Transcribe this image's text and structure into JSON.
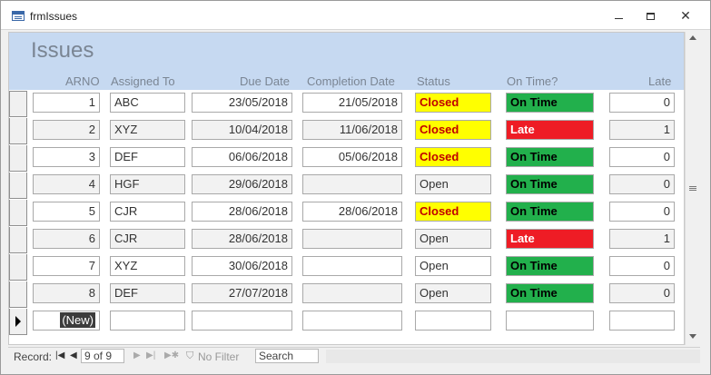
{
  "window": {
    "title": "frmIssues"
  },
  "form": {
    "title": "Issues",
    "columns": [
      "ARNO",
      "Assigned To",
      "Due Date",
      "Completion Date",
      "Status",
      "On Time?",
      "Late"
    ]
  },
  "rows": [
    {
      "arno": "1",
      "assigned": "ABC",
      "due": "23/05/2018",
      "completion": "21/05/2018",
      "status": "Closed",
      "ontime": "On Time",
      "late": "0"
    },
    {
      "arno": "2",
      "assigned": "XYZ",
      "due": "10/04/2018",
      "completion": "11/06/2018",
      "status": "Closed",
      "ontime": "Late",
      "late": "1"
    },
    {
      "arno": "3",
      "assigned": "DEF",
      "due": "06/06/2018",
      "completion": "05/06/2018",
      "status": "Closed",
      "ontime": "On Time",
      "late": "0"
    },
    {
      "arno": "4",
      "assigned": "HGF",
      "due": "29/06/2018",
      "completion": "",
      "status": "Open",
      "ontime": "On Time",
      "late": "0"
    },
    {
      "arno": "5",
      "assigned": "CJR",
      "due": "28/06/2018",
      "completion": "28/06/2018",
      "status": "Closed",
      "ontime": "On Time",
      "late": "0"
    },
    {
      "arno": "6",
      "assigned": "CJR",
      "due": "28/06/2018",
      "completion": "",
      "status": "Open",
      "ontime": "Late",
      "late": "1"
    },
    {
      "arno": "7",
      "assigned": "XYZ",
      "due": "30/06/2018",
      "completion": "",
      "status": "Open",
      "ontime": "On Time",
      "late": "0"
    },
    {
      "arno": "8",
      "assigned": "DEF",
      "due": "27/07/2018",
      "completion": "",
      "status": "Open",
      "ontime": "On Time",
      "late": "0"
    }
  ],
  "new_record": {
    "arno": "(New)"
  },
  "navigation": {
    "label": "Record:",
    "position": "9 of 9",
    "filter": "No Filter",
    "search": "Search"
  },
  "colors": {
    "header_band": "#c6d9f1",
    "closed_bg": "#ffff00",
    "closed_text": "#c00000",
    "ontime_bg": "#22b04c",
    "late_bg": "#ee1c25"
  }
}
